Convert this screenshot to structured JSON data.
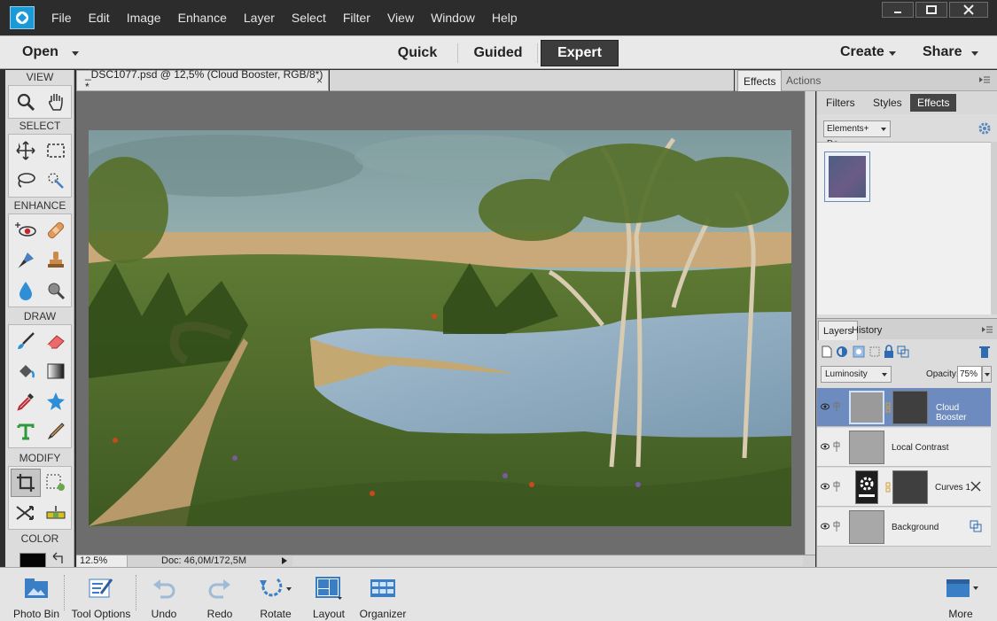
{
  "menubar": {
    "items": [
      "File",
      "Edit",
      "Image",
      "Enhance",
      "Layer",
      "Select",
      "Filter",
      "View",
      "Window",
      "Help"
    ]
  },
  "modebar": {
    "open": "Open",
    "tabs": {
      "quick": "Quick",
      "guided": "Guided",
      "expert": "Expert"
    },
    "create": "Create",
    "share": "Share",
    "active_tab": "Expert"
  },
  "toolbox": {
    "sections": {
      "view": "VIEW",
      "select": "SELECT",
      "enhance": "ENHANCE",
      "draw": "DRAW",
      "modify": "MODIFY",
      "color": "COLOR"
    },
    "foreground_color": "#050505"
  },
  "document": {
    "tab_title": "_DSC1077.psd @ 12,5% (Cloud Booster, RGB/8*) *",
    "close": "×",
    "zoom": "12.5%",
    "doc_info": "Doc: 46,0M/172,5M"
  },
  "panel": {
    "top_tabs": {
      "effects": "Effects",
      "actions": "Actions"
    },
    "sub_tabs": {
      "filters": "Filters",
      "styles": "Styles",
      "effects": "Effects"
    },
    "preset": "Elements+ De..."
  },
  "layers_panel": {
    "tabs": {
      "layers": "Layers",
      "history": "History"
    },
    "blend_mode": "Luminosity",
    "opacity_label": "Opacity:",
    "opacity_value": "75%",
    "layers": [
      {
        "name": "Cloud Booster",
        "selected": true
      },
      {
        "name": "Local Contrast",
        "selected": false
      },
      {
        "name": "Curves 1",
        "selected": false
      },
      {
        "name": "Background",
        "selected": false
      }
    ]
  },
  "bottombar": {
    "photo_bin": "Photo Bin",
    "tool_options": "Tool Options",
    "undo": "Undo",
    "redo": "Redo",
    "rotate": "Rotate",
    "layout": "Layout",
    "organizer": "Organizer",
    "more": "More"
  },
  "colors": {
    "accent": "#1a9bd7",
    "selected_layer": "#6d8bbf",
    "expert_tab": "#3c3c3c"
  }
}
